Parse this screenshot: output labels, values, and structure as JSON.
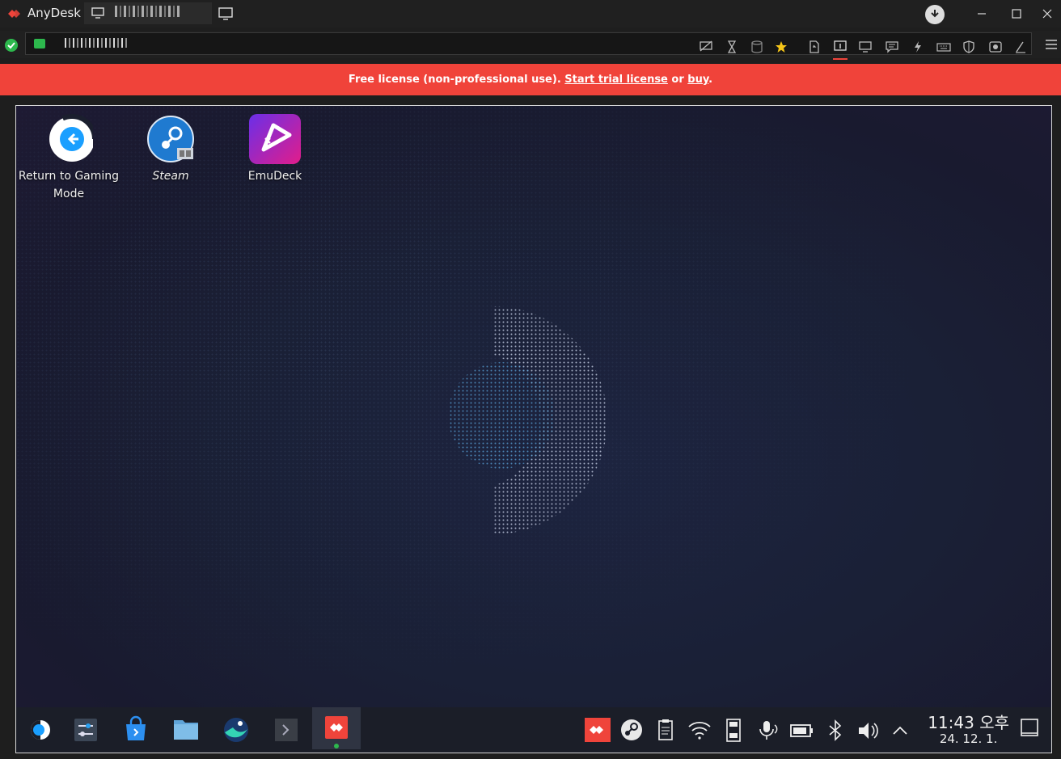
{
  "window": {
    "app_name": "AnyDesk",
    "tab_label": "",
    "colors": {
      "accent": "#ef443b",
      "status_ok": "#2db84d",
      "banner_bg": "#f0433a"
    }
  },
  "toolbar": {
    "icons": [
      "display-off-icon",
      "hourglass-icon",
      "database-icon",
      "star-icon",
      "file-transfer-icon",
      "monitor-1-icon",
      "screen-icon",
      "chat-icon",
      "action-icon",
      "keyboard-icon",
      "shield-icon",
      "record-icon",
      "whiteboard-icon"
    ],
    "menu_icon": "hamburger-menu-icon"
  },
  "banner": {
    "text": "Free license (non-professional use).",
    "trial_link": "Start trial license",
    "or": "or",
    "buy_link": "buy",
    "period": "."
  },
  "desktop": {
    "icons": [
      {
        "label": "Return to Gaming Mode",
        "icon": "return-arrow-icon"
      },
      {
        "label": "Steam",
        "icon": "steam-icon"
      },
      {
        "label": "EmuDeck",
        "icon": "emudeck-icon"
      }
    ]
  },
  "taskbar": {
    "apps": [
      "steamos-menu-icon",
      "system-settings-icon",
      "discover-store-icon",
      "file-manager-icon",
      "browser-icon",
      "terminal-icon",
      "anydesk-icon"
    ],
    "tray": [
      "anydesk-tray-icon",
      "steam-tray-icon",
      "clipboard-icon",
      "wifi-icon",
      "storage-icon",
      "microphone-icon",
      "battery-icon",
      "bluetooth-icon",
      "volume-icon",
      "expand-tray-icon"
    ],
    "time": "11:43 오후",
    "date": "24. 12. 1."
  }
}
